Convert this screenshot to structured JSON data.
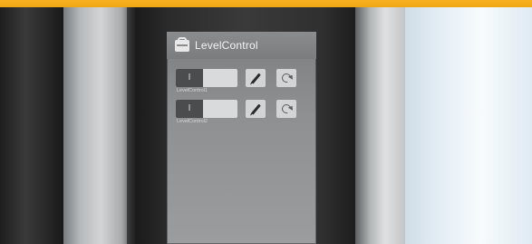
{
  "app": {
    "title": "LevelControl",
    "icon": "toolbox-icon"
  },
  "controls": [
    {
      "label": "LevelControl1",
      "state": "I",
      "edit_icon": "pen-icon",
      "reset_icon": "reset-icon"
    },
    {
      "label": "LevelControl2",
      "state": "I",
      "edit_icon": "pen-icon",
      "reset_icon": "reset-icon"
    }
  ],
  "colors": {
    "accent_top_bar": "#f7b020",
    "screen_background": "#8e9092",
    "button_background": "#d3d4d5"
  }
}
